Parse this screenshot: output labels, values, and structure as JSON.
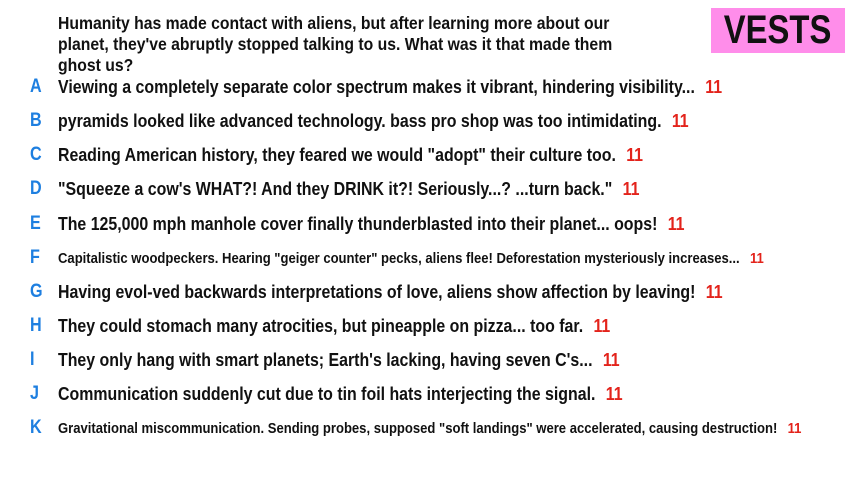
{
  "prompt": "Humanity has made contact with aliens, but after learning more about our planet, they've abruptly stopped talking to us. What was it that made them ghost us?",
  "badge": "VESTS",
  "colors": {
    "letter": "#1e7fe0",
    "score": "#e3231b",
    "badge_bg": "#ff8dea",
    "text": "#111111"
  },
  "answers": [
    {
      "letter": "A",
      "text": "Viewing a completely separate color spectrum makes it vibrant, hindering visibility...",
      "score": "11"
    },
    {
      "letter": "B",
      "text": "pyramids looked like advanced technology. bass pro shop was too intimidating.",
      "score": "11"
    },
    {
      "letter": "C",
      "text": "Reading American history, they feared we would \"adopt\" their culture too.",
      "score": "11"
    },
    {
      "letter": "D",
      "text": "\"Squeeze a cow's WHAT?! And they DRINK it?! Seriously...? ...turn back.\"",
      "score": "11"
    },
    {
      "letter": "E",
      "text": "The 125,000 mph manhole cover finally thunderblasted into their planet... oops!",
      "score": "11"
    },
    {
      "letter": "F",
      "text": "Capitalistic woodpeckers. Hearing \"geiger counter\" pecks, aliens flee! Deforestation mysteriously increases...",
      "score": "11"
    },
    {
      "letter": "G",
      "text": "Having evol-ved backwards interpretations of love, aliens show affection by leaving!",
      "score": "11"
    },
    {
      "letter": "H",
      "text": "They could stomach many atrocities, but pineapple on pizza... too far.",
      "score": "11"
    },
    {
      "letter": "I",
      "text": "They only hang with smart planets; Earth's lacking, having seven C's...",
      "score": "11"
    },
    {
      "letter": "J",
      "text": "Communication suddenly cut due to tin foil hats interjecting the signal.",
      "score": "11"
    },
    {
      "letter": "K",
      "text": "Gravitational miscommunication. Sending probes, supposed \"soft landings\" were accelerated, causing destruction!",
      "score": "11"
    }
  ]
}
